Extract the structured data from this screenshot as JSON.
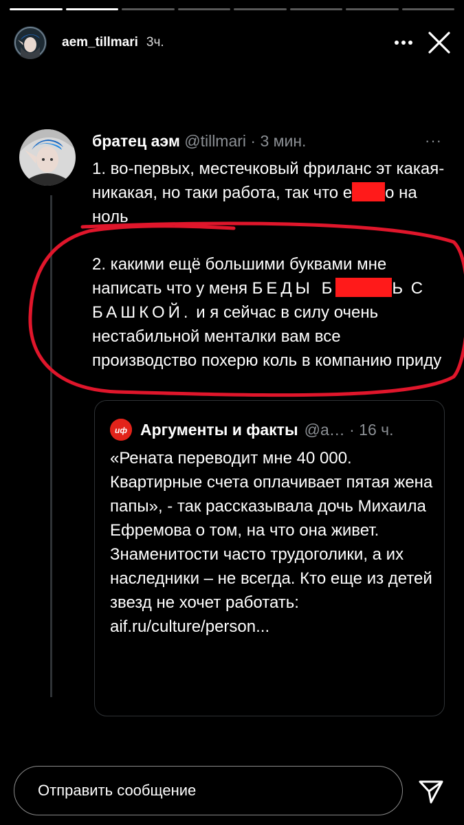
{
  "story": {
    "progress_total": 8,
    "progress_done": 2,
    "username": "aem_tillmari",
    "time": "3ч.",
    "more_icon": "more-horizontal-icon",
    "close_icon": "close-icon"
  },
  "tweet": {
    "author_name": "братец аэм",
    "handle": "@tillmari",
    "dot": "·",
    "time": "3 мин.",
    "more": "···",
    "p1_a": "1. во-первых, местечковый фриланс эт какая-никакая, но таки работа, так что е",
    "p1_b": "о на ноль",
    "p2_a": "2. какими ещё большими буквами мне написать что у меня ",
    "p2_caps1": "БЕДЫ Б",
    "p2_caps2": "Ь",
    "p2_caps3": "С БАШКОЙ.",
    "p2_b": " и я сейчас в силу очень нестабильной менталки вам все производство похерю коль в компанию приду"
  },
  "quote": {
    "logo_text": "АиФ",
    "name": "Аргументы и факты",
    "handle": "@a… · 16 ч.",
    "text": "«Рената переводит мне 40 000. Квартирные счета оплачивает пятая жена папы», - так рассказывала дочь Михаила Ефремова о том, на что она живет. Знаменитости часто трудоголики, а их наследники – не всегда. Кто еще из детей звезд не хочет работать:",
    "link": "aif.ru/culture/person..."
  },
  "composer": {
    "placeholder": "Отправить сообщение",
    "send_icon": "send-icon"
  },
  "colors": {
    "background": "#000000",
    "annotation_red": "#e0162b",
    "redaction": "#ff1a1a",
    "muted_text": "#8b8f94",
    "aif_red": "#e2231a"
  }
}
